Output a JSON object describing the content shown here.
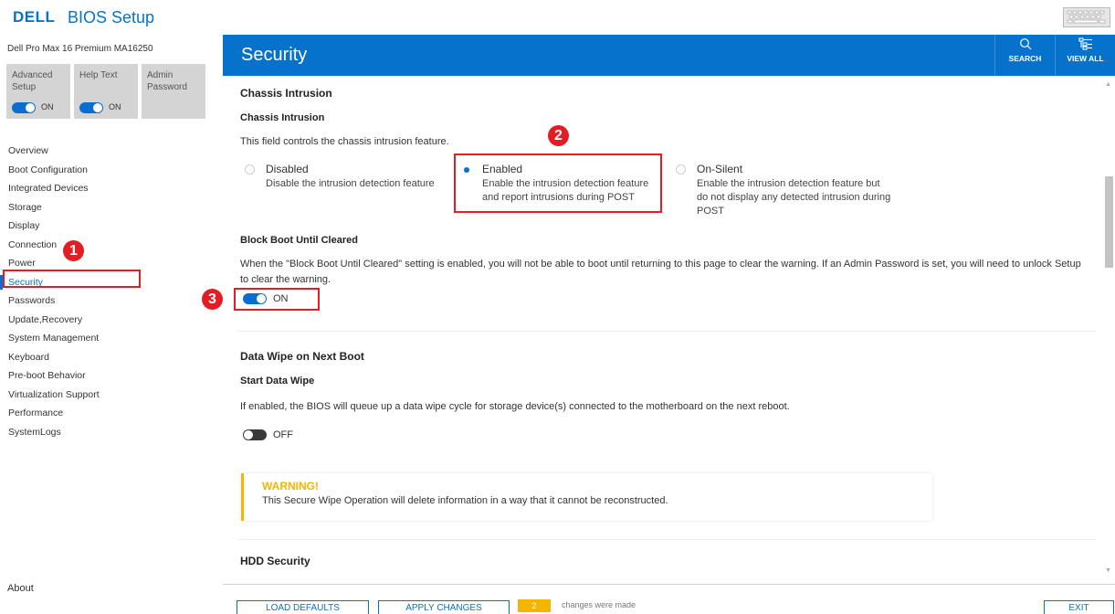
{
  "app": {
    "brand": "DELL",
    "title": "BIOS Setup",
    "icons": {
      "keyboard": "keyboard-icon"
    }
  },
  "sidebar": {
    "model": "Dell Pro Max 16 Premium MA16250",
    "cards": [
      {
        "label": "Advanced Setup",
        "toggle": "ON",
        "on": true
      },
      {
        "label": "Help Text",
        "toggle": "ON",
        "on": true
      },
      {
        "label": "Admin Password"
      }
    ],
    "nav": [
      "Overview",
      "Boot Configuration",
      "Integrated Devices",
      "Storage",
      "Display",
      "Connection",
      "Power",
      "Security",
      "Passwords",
      "Update,Recovery",
      "System Management",
      "Keyboard",
      "Pre-boot Behavior",
      "Virtualization Support",
      "Performance",
      "SystemLogs"
    ],
    "active": "Security",
    "about": "About"
  },
  "header": {
    "title": "Security",
    "search_label": "SEARCH",
    "viewall_label": "VIEW ALL"
  },
  "content": {
    "chassis": {
      "section_title": "Chassis Intrusion",
      "field_title": "Chassis Intrusion",
      "description": "This field controls the chassis intrusion feature.",
      "options": [
        {
          "title": "Disabled",
          "desc": "Disable the intrusion detection feature",
          "selected": false
        },
        {
          "title": "Enabled",
          "desc": "Enable the intrusion detection feature and report intrusions during POST",
          "selected": true
        },
        {
          "title": "On-Silent",
          "desc": "Enable the intrusion detection feature but do not display any detected intrusion during POST",
          "selected": false
        }
      ]
    },
    "block_boot": {
      "title": "Block Boot Until Cleared",
      "description_line1": "When the \"Block Boot Until Cleared\" setting is enabled, you will not be able to boot until returning to this page to clear the warning. If an Admin Password is set, you will need to unlock Setup",
      "description_line2": "to clear the warning.",
      "toggle": "ON",
      "on": true
    },
    "data_wipe": {
      "section_title": "Data Wipe on Next Boot",
      "field_title": "Start Data Wipe",
      "description": "If enabled, the BIOS will queue up a data wipe cycle for storage device(s) connected to the motherboard on the next reboot.",
      "toggle": "OFF",
      "on": false
    },
    "warning": {
      "title": "WARNING!",
      "text": "This Secure Wipe Operation will delete information in a way that it cannot be reconstructed."
    },
    "hdd": {
      "section_title": "HDD Security"
    }
  },
  "footer": {
    "load_defaults": "LOAD DEFAULTS",
    "apply_changes": "APPLY CHANGES",
    "changes_count": "2",
    "changes_text": "changes were made",
    "exit": "EXIT"
  },
  "annotations": {
    "mark1": "1",
    "mark2": "2",
    "mark3": "3",
    "color": "#e41c24"
  },
  "colors": {
    "accent": "#0672cb",
    "warning": "#f2b600",
    "annotation": "#e41c24"
  }
}
